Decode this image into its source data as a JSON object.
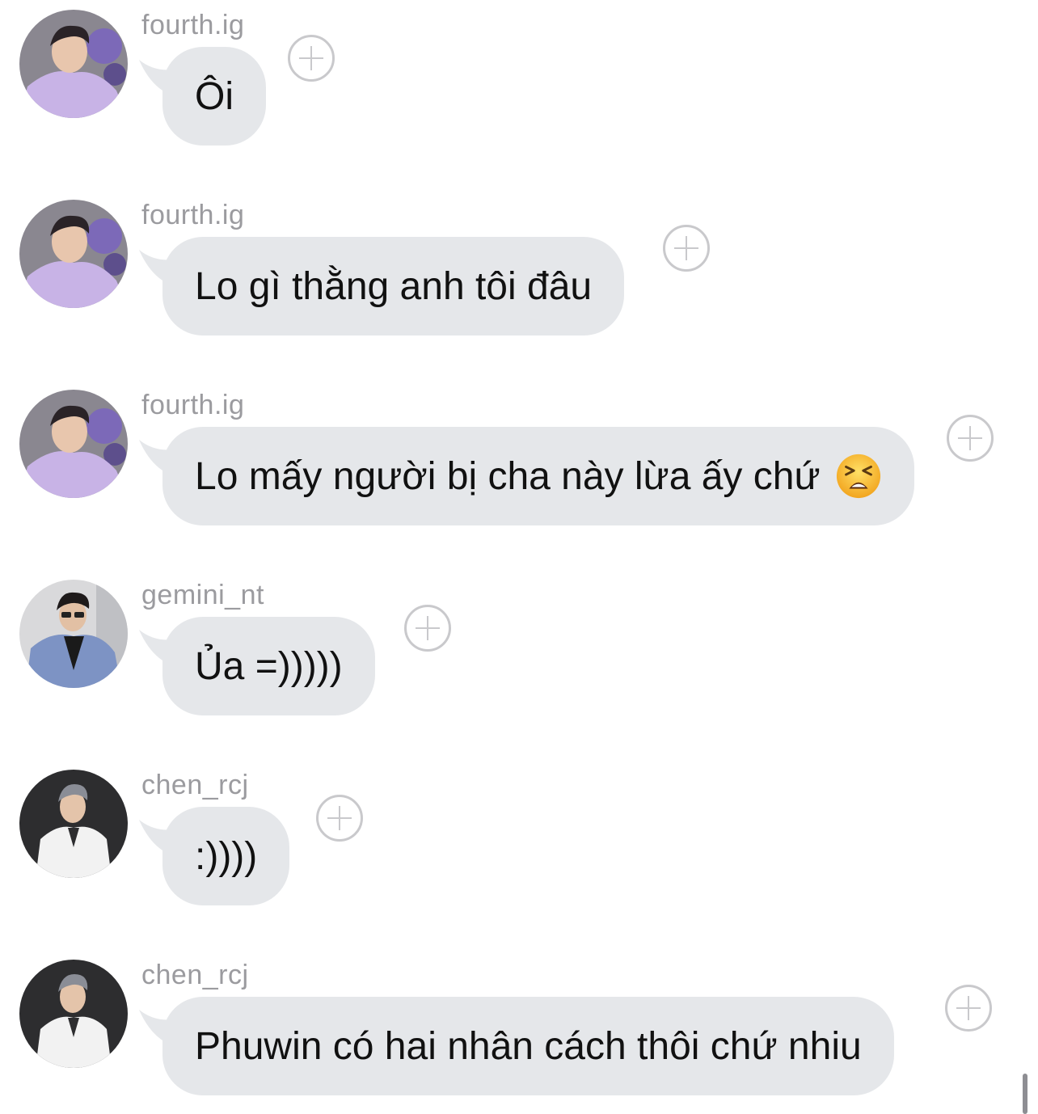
{
  "messages": [
    {
      "user": "fourth.ig",
      "text": "Ôi",
      "avatar": "avatar-purple-hoodie"
    },
    {
      "user": "fourth.ig",
      "text": "Lo gì thằng anh tôi đâu",
      "avatar": "avatar-purple-hoodie"
    },
    {
      "user": "fourth.ig",
      "text": "Lo mấy người bị cha này lừa ấy chứ",
      "emoji": "tired-face",
      "avatar": "avatar-purple-hoodie"
    },
    {
      "user": "gemini_nt",
      "text": "Ủa =)))))",
      "avatar": "avatar-blue-suit"
    },
    {
      "user": "chen_rcj",
      "text": ":))))",
      "avatar": "avatar-white-shirt"
    },
    {
      "user": "chen_rcj",
      "text": "Phuwin có hai nhân cách thôi chứ nhiu",
      "avatar": "avatar-white-shirt"
    }
  ],
  "colors": {
    "bubble": "#e5e7ea",
    "username": "#9b9b9f",
    "text": "#111111",
    "plus": "#c9c9cc"
  }
}
